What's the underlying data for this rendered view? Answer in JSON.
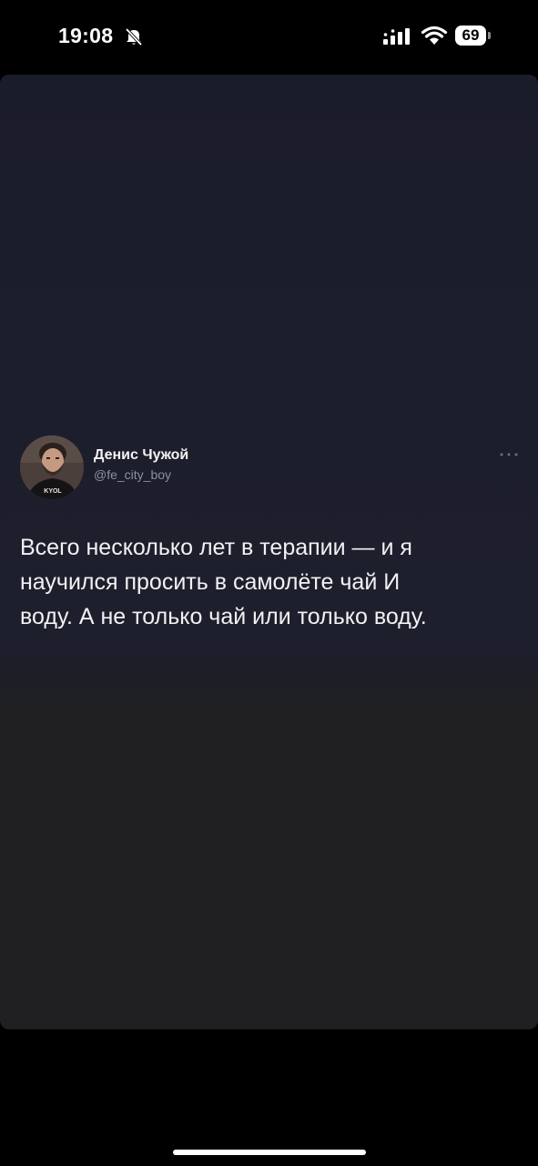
{
  "status_bar": {
    "time": "19:08",
    "battery_level": "69",
    "icons": [
      "bell-off-icon",
      "signal-icon",
      "wifi-icon",
      "battery-icon"
    ]
  },
  "tweet": {
    "author_name": "Денис Чужой",
    "author_handle": "@fe_city_boy",
    "avatar_shirt_text": "KYOL",
    "text": "Всего несколько лет в терапии — и я\nнаучился просить в самолёте чай И\nводу. А не только чай или только воду."
  },
  "colors": {
    "background": "#000000",
    "card": "#202023",
    "tweet_image_bg": "#1c1d2b",
    "text": "#f1f1f3",
    "handle": "#8d8f9c"
  }
}
